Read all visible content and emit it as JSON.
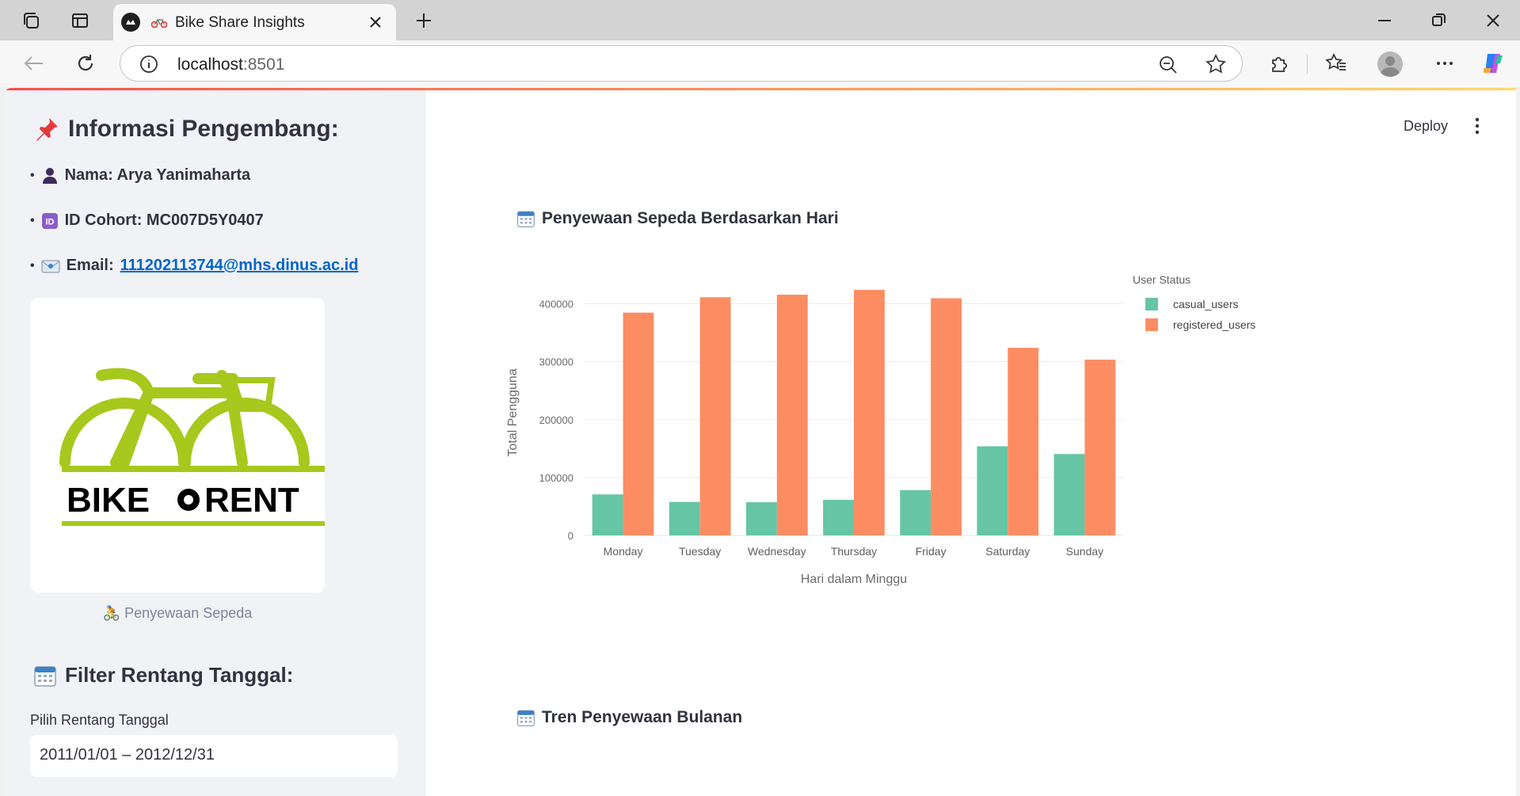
{
  "browser": {
    "tab_title": "Bike Share Insights",
    "url_host": "localhost",
    "url_port": ":8501"
  },
  "sidebar": {
    "heading": "Informasi Pengembang:",
    "name_label": "Nama: Arya Yanimaharta",
    "cohort_label": "ID Cohort: MC007D5Y0407",
    "email_prefix": "Email:",
    "email": "111202113744@mhs.dinus.ac.id",
    "logo_text_left": "BIKE",
    "logo_text_right": "RENT",
    "logo_caption": "Penyewaan Sepeda",
    "filter_heading": "Filter Rentang Tanggal:",
    "date_label": "Pilih Rentang Tanggal",
    "date_value": "2011/01/01 – 2012/12/31"
  },
  "main": {
    "deploy_label": "Deploy",
    "chart1_title": "Penyewaan Sepeda Berdasarkan Hari",
    "chart2_title": "Tren Penyewaan Bulanan"
  },
  "chart_data": {
    "type": "bar",
    "categories": [
      "Monday",
      "Tuesday",
      "Wednesday",
      "Thursday",
      "Friday",
      "Saturday",
      "Sunday"
    ],
    "series": [
      {
        "name": "casual_users",
        "color": "#66c5a5",
        "values": [
          70784,
          57843,
          57319,
          61460,
          78238,
          153852,
          140521
        ]
      },
      {
        "name": "registered_users",
        "color": "#fc8d62",
        "values": [
          384719,
          411266,
          415729,
          423935,
          409552,
          323955,
          303506
        ]
      }
    ],
    "xlabel": "Hari dalam Minggu",
    "ylabel": "Total Pengguna",
    "legend_title": "User Status",
    "yticks": [
      0,
      100000,
      200000,
      300000,
      400000
    ],
    "ylim": [
      0,
      424000
    ],
    "grid": true,
    "legend_position": "top-right"
  }
}
